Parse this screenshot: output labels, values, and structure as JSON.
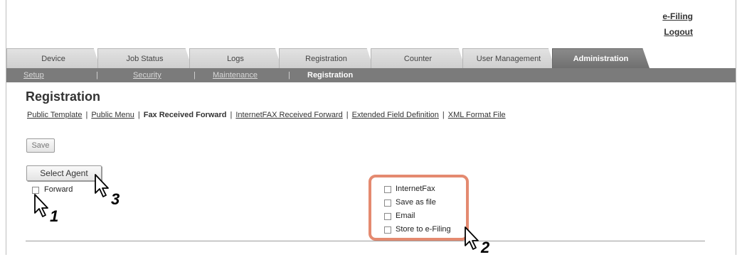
{
  "top_links": {
    "efiling": "e-Filing",
    "logout": "Logout"
  },
  "tabs": [
    {
      "label": "Device"
    },
    {
      "label": "Job Status"
    },
    {
      "label": "Logs"
    },
    {
      "label": "Registration"
    },
    {
      "label": "Counter"
    },
    {
      "label": "User Management"
    },
    {
      "label": "Administration"
    }
  ],
  "subnav": {
    "setup": "Setup",
    "security": "Security",
    "maintenance": "Maintenance",
    "registration": "Registration",
    "separator": "|"
  },
  "page": {
    "title": "Registration"
  },
  "sublinks": {
    "public_template": "Public Template",
    "public_menu": "Public Menu",
    "fax_received_forward": "Fax Received Forward",
    "internetfax_received_forward": "InternetFAX Received Forward",
    "extended_field_definition": "Extended Field Definition",
    "xml_format_file": "XML Format File",
    "separator": "|"
  },
  "buttons": {
    "save": "Save",
    "select_agent": "Select Agent"
  },
  "forward": {
    "label": "Forward"
  },
  "agents": [
    {
      "label": "InternetFax"
    },
    {
      "label": "Save as file"
    },
    {
      "label": "Email"
    },
    {
      "label": "Store to e-Filing"
    }
  ],
  "steps": {
    "s1": "1",
    "s2": "2",
    "s3": "3"
  },
  "colors": {
    "callout": "#e48a70",
    "active_tab": "#7b7b7b"
  }
}
